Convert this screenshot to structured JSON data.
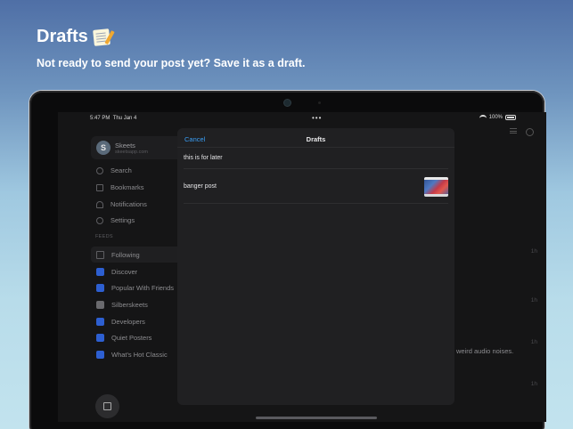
{
  "hero": {
    "title": "Drafts",
    "title_icon": "memo-icon",
    "subtitle": "Not ready to send your post yet? Save it as a draft."
  },
  "status_bar": {
    "time": "5:47 PM",
    "date": "Thu Jan 4",
    "dots": "•••",
    "battery": "100%"
  },
  "sidebar": {
    "account": {
      "avatar_letter": "S",
      "name": "Skeets",
      "domain": "skeetsapp.com"
    },
    "nav_items": [
      {
        "label": "Search",
        "icon": "search-icon"
      },
      {
        "label": "Bookmarks",
        "icon": "bookmark-icon"
      },
      {
        "label": "Notifications",
        "icon": "bell-icon"
      },
      {
        "label": "Settings",
        "icon": "gear-icon"
      }
    ],
    "feeds_header": "FEEDS",
    "feeds": [
      {
        "label": "Following",
        "icon": "home-icon"
      },
      {
        "label": "Discover",
        "icon": "feed-icon"
      },
      {
        "label": "Popular With Friends",
        "icon": "feed-icon"
      },
      {
        "label": "Silberskeets",
        "icon": "feed-icon"
      },
      {
        "label": "Developers",
        "icon": "feed-icon"
      },
      {
        "label": "Quiet Posters",
        "icon": "feed-icon"
      },
      {
        "label": "What's Hot Classic",
        "icon": "feed-icon"
      }
    ]
  },
  "background_timeline": {
    "times": [
      "1h",
      "1h",
      "1h",
      "1h"
    ],
    "snippet": "weird audio noises."
  },
  "drafts_sheet": {
    "cancel_label": "Cancel",
    "title": "Drafts",
    "drafts": [
      {
        "text": "this is for later",
        "has_image": false
      },
      {
        "text": "banger post",
        "has_image": true
      }
    ]
  },
  "colors": {
    "accent": "#3a9ef5",
    "feed_icon": "#2d5fd1"
  }
}
